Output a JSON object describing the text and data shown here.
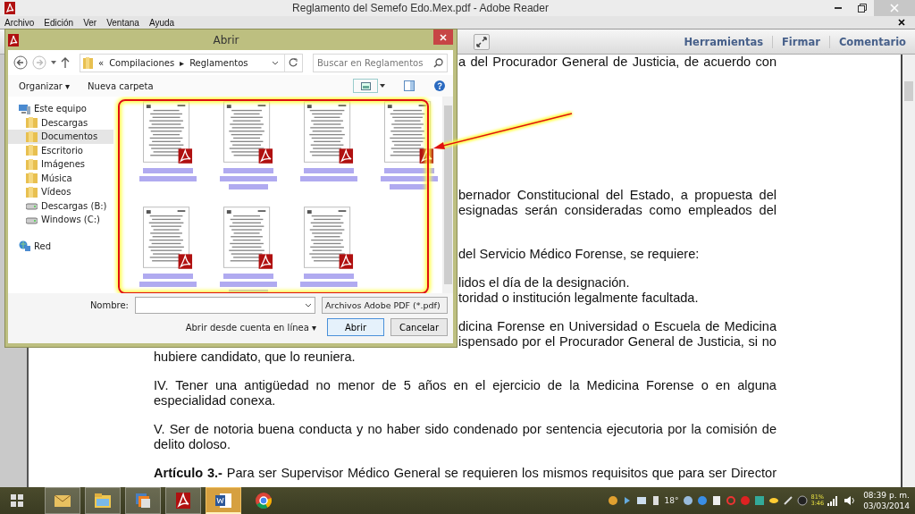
{
  "window": {
    "title": "Reglamento del Semefo Edo.Mex.pdf - Adobe Reader"
  },
  "menu": [
    "Archivo",
    "Edición",
    "Ver",
    "Ventana",
    "Ayuda"
  ],
  "toolbar": {
    "links": [
      "Herramientas",
      "Firmar",
      "Comentario"
    ]
  },
  "document": {
    "paragraphs": [
      {
        "lines": [
          {
            "text": "a del Procurador General de Justicia, de acuerdo con",
            "hidden_start": true,
            "justify": true
          }
        ]
      },
      {
        "lines": [
          {
            "text": "bernador Constitucional del Estado, a propuesta del",
            "hidden_start": true,
            "justify": true
          },
          {
            "text": "esignadas serán consideradas como empleados del",
            "hidden_start": true,
            "justify": true
          }
        ]
      },
      {
        "lines": [
          {
            "text": "del Servicio Médico Forense, se requiere:",
            "hidden_start": true,
            "justify": false
          }
        ]
      },
      {
        "lines": [
          {
            "text": "lidos el día de la designación.",
            "hidden_start": true,
            "justify": false
          },
          {
            "text": "toridad o institución legalmente facultada.",
            "hidden_start": true,
            "justify": false
          }
        ]
      },
      {
        "lines": [
          {
            "text": "dicina Forense en Universidad o Escuela de Medicina",
            "hidden_start": true,
            "justify": true
          },
          {
            "text": "ispensado por el Procurador General de Justicia, si no",
            "hidden_start": true,
            "justify": true
          },
          {
            "text": "hubiere candidato, que lo reuniera.",
            "hidden_start": false,
            "justify": false
          }
        ]
      },
      {
        "lines": [
          {
            "text": "IV. Tener una antigüedad no menor de 5 años en el ejercicio de la Medicina Forense o en alguna",
            "hidden_start": false,
            "justify": true
          },
          {
            "text": "especialidad conexa.",
            "hidden_start": false,
            "justify": false
          }
        ]
      },
      {
        "lines": [
          {
            "text": "V. Ser de notoria buena conducta y no haber sido condenado por sentencia ejecutoria por la comisión de",
            "hidden_start": false,
            "justify": true
          },
          {
            "text": "delito doloso.",
            "hidden_start": false,
            "justify": false
          }
        ]
      },
      {
        "lines": [
          {
            "text": "**Artículo 3.-** Para ser Supervisor Médico General se requieren los mismos requisitos que para ser Director",
            "hidden_start": false,
            "justify": true
          }
        ]
      }
    ]
  },
  "dialog": {
    "title": "Abrir",
    "path": [
      "«",
      "Compilaciones",
      "▸",
      "Reglamentos"
    ],
    "search": {
      "placeholder": "Buscar en Reglamentos"
    },
    "commands": [
      {
        "label": "Organizar ▾"
      },
      {
        "label": "Nueva carpeta"
      }
    ],
    "nav": [
      {
        "label": "Este equipo",
        "kind": "computer",
        "selected": false,
        "children": [
          {
            "label": "Descargas",
            "kind": "folder",
            "selected": false
          },
          {
            "label": "Documentos",
            "kind": "folder",
            "selected": true
          },
          {
            "label": "Escritorio",
            "kind": "folder",
            "selected": false
          },
          {
            "label": "Imágenes",
            "kind": "folder",
            "selected": false
          },
          {
            "label": "Música",
            "kind": "folder",
            "selected": false
          },
          {
            "label": "Vídeos",
            "kind": "folder",
            "selected": false
          },
          {
            "label": "Descargas (B:)",
            "kind": "drive",
            "selected": false
          },
          {
            "label": "Windows (C:)",
            "kind": "drive",
            "selected": false
          }
        ]
      },
      {
        "label": "Red",
        "kind": "network",
        "selected": false
      }
    ],
    "files": [
      {
        "kind": "pdf"
      },
      {
        "kind": "pdf"
      },
      {
        "kind": "pdf"
      },
      {
        "kind": "pdf"
      },
      {
        "kind": "pdf"
      },
      {
        "kind": "pdf"
      },
      {
        "kind": "pdf"
      }
    ],
    "name_label": "Nombre:",
    "filter": "Archivos Adobe PDF (*.pdf)",
    "online": "Abrir desde cuenta en línea ▾",
    "buttons": [
      {
        "label": "Abrir",
        "default": true
      },
      {
        "label": "Cancelar",
        "default": false
      }
    ]
  },
  "taskbar": {
    "apps": [
      {
        "kind": "mail",
        "running": true,
        "active": false
      },
      {
        "kind": "folder",
        "running": true,
        "active": false
      },
      {
        "kind": "stack",
        "running": true,
        "active": false
      },
      {
        "kind": "pdf",
        "running": true,
        "active": false
      },
      {
        "kind": "word",
        "running": true,
        "active": true
      },
      {
        "kind": "chrome",
        "running": false,
        "active": false
      }
    ],
    "weather": "18°",
    "battery": [
      "81%",
      "3:46"
    ],
    "time": "08:39 p. m.",
    "date": "03/03/2014"
  }
}
